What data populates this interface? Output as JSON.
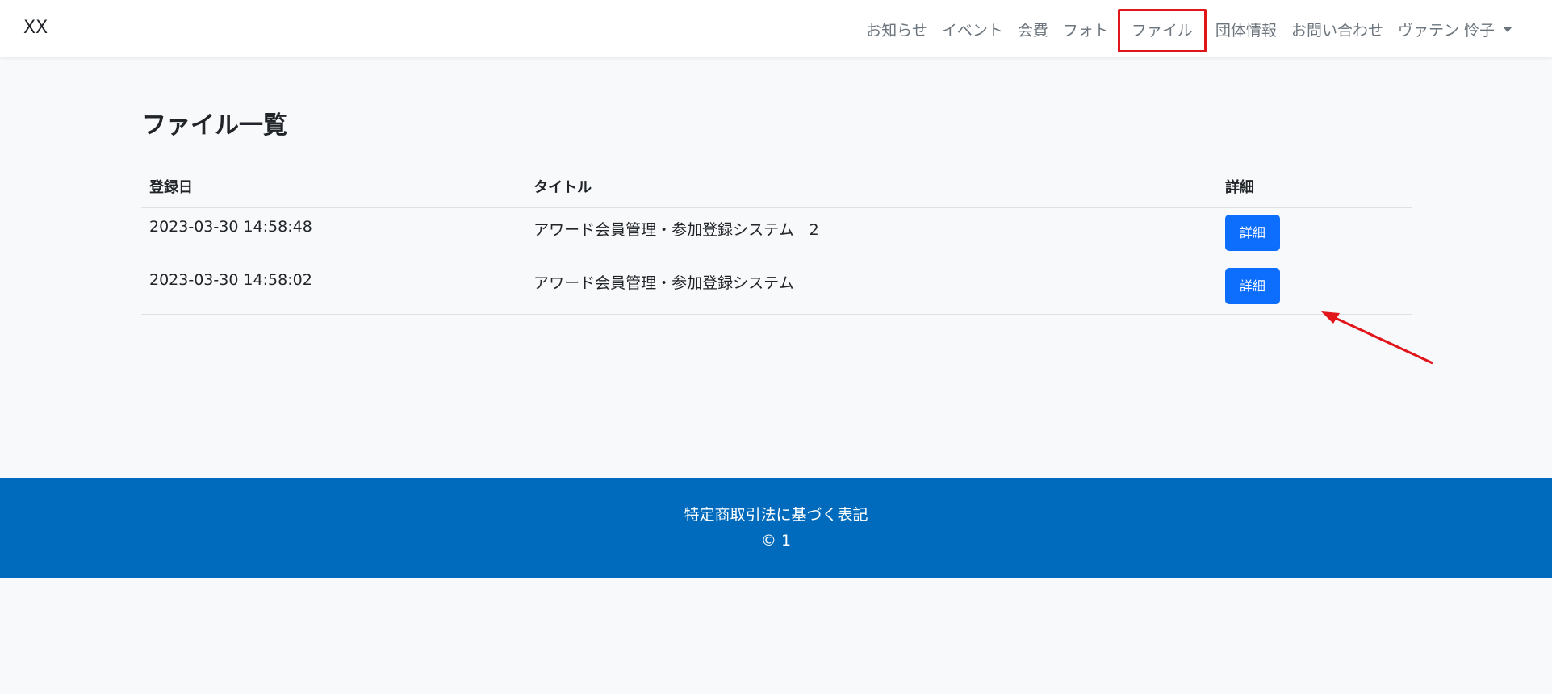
{
  "navbar": {
    "brand": "XX",
    "items": [
      {
        "label": "お知らせ"
      },
      {
        "label": "イベント"
      },
      {
        "label": "会費"
      },
      {
        "label": "フォト"
      },
      {
        "label": "ファイル"
      },
      {
        "label": "団体情報"
      },
      {
        "label": "お問い合わせ"
      }
    ],
    "user_menu": "ヴァテン 怜子"
  },
  "main": {
    "title": "ファイル一覧",
    "table": {
      "headers": [
        "登録日",
        "タイトル",
        "詳細"
      ],
      "rows": [
        {
          "date": "2023-03-30 14:58:48",
          "title": "アワード会員管理・参加登録システム　2",
          "button": "詳細"
        },
        {
          "date": "2023-03-30 14:58:02",
          "title": "アワード会員管理・参加登録システム",
          "button": "詳細"
        }
      ]
    }
  },
  "footer": {
    "link": "特定商取引法に基づく表記",
    "copyright": "© 1"
  },
  "colors": {
    "primary_button": "#0d6efd",
    "footer_bg": "#006bbc",
    "annotation": "#e0161b"
  }
}
